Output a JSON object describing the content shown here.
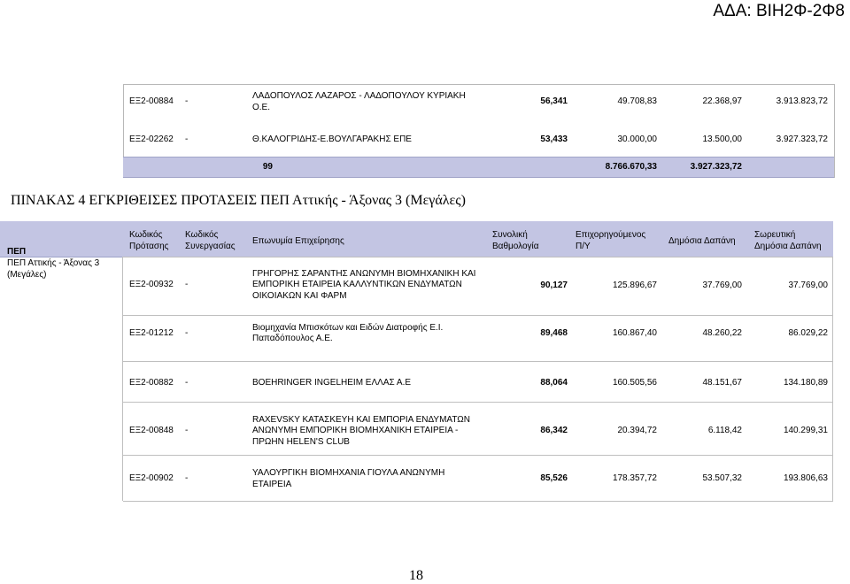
{
  "header_stamp": "ΑΔΑ: ΒΙΗ2Φ-2Φ8",
  "prev_rows": [
    {
      "code": "ΕΞ2-00884",
      "partner": "-",
      "name_lines": [
        "ΛΑΔΟΠΟΥΛΟΣ ΛΑΖΑΡΟΣ - ΛΑΔΟΠΟΥΛΟΥ ΚΥΡΙΑΚΗ",
        "Ο.Ε."
      ],
      "score": "56,341",
      "budget": "49.708,83",
      "public": "22.368,97",
      "cumulative": "3.913.823,72"
    },
    {
      "code": "ΕΞ2-02262",
      "partner": "-",
      "name_lines": [
        "Θ.ΚΑΛΟΓΡΙΔΗΣ-Ε.ΒΟΥΛΓΑΡΑΚΗΣ ΕΠΕ"
      ],
      "score": "53,433",
      "budget": "30.000,00",
      "public": "13.500,00",
      "cumulative": "3.927.323,72"
    }
  ],
  "totals": {
    "count": "99",
    "budget": "8.766.670,33",
    "public": "3.927.323,72"
  },
  "section_title": "ΠΙΝΑΚΑΣ 4 ΕΓΚΡΙΘΕΙΣΕΣ ΠΡΟΤΑΣΕΙΣ ΠΕΠ Αττικής - Άξονας 3 (Μεγάλες)",
  "headers": {
    "pep": "ΠΕΠ",
    "code": [
      "Κωδικός",
      "Πρότασης"
    ],
    "partner": [
      "Κωδικός",
      "Συνεργασίας"
    ],
    "name": "Επωνυμία Επιχείρησης",
    "score": [
      "Συνολική",
      "Βαθμολογία"
    ],
    "budget": [
      "Επιχορηγούμενος",
      "Π/Υ"
    ],
    "public": "Δημόσια Δαπάνη",
    "cumulative": [
      "Σωρευτική",
      "Δημόσια Δαπάνη"
    ]
  },
  "pep_value": [
    "ΠΕΠ Αττικής - Άξονας 3",
    "(Μεγάλες)"
  ],
  "rows": [
    {
      "code": "ΕΞ2-00932",
      "partner": "-",
      "name_lines": [
        "ΓΡΗΓΟΡΗΣ ΣΑΡΑΝΤΗΣ ΑΝΩΝΥΜΗ ΒΙΟΜΗΧΑΝΙΚΗ ΚΑΙ",
        "ΕΜΠΟΡΙΚΗ ΕΤΑΙΡΕΙΑ ΚΑΛΛΥΝΤΙΚΩΝ ΕΝΔΥΜΑΤΩΝ",
        "ΟΙΚΟΙΑΚΩΝ ΚΑΙ ΦΑΡΜ"
      ],
      "score": "90,127",
      "budget": "125.896,67",
      "public": "37.769,00",
      "cumulative": "37.769,00"
    },
    {
      "code": "ΕΞ2-01212",
      "partner": "-",
      "name_lines": [
        "Βιομηχανία Μπισκότων και Ειδών Διατροφής Ε.Ι.",
        "Παπαδόπουλος Α.Ε."
      ],
      "score": "89,468",
      "budget": "160.867,40",
      "public": "48.260,22",
      "cumulative": "86.029,22"
    },
    {
      "code": "ΕΞ2-00882",
      "partner": "-",
      "name_lines": [
        "BOEHRINGER INGELHEIM ΕΛΛΑΣ Α.Ε"
      ],
      "score": "88,064",
      "budget": "160.505,56",
      "public": "48.151,67",
      "cumulative": "134.180,89"
    },
    {
      "code": "ΕΞ2-00848",
      "partner": "-",
      "name_lines": [
        "RAXEVSKY ΚΑΤΑΣΚΕΥΗ ΚΑΙ ΕΜΠΟΡΙΑ ΕΝΔΥΜΑΤΩΝ",
        "ΑΝΩΝΥΜΗ ΕΜΠΟΡΙΚΗ ΒΙΟΜΗΧΑΝΙΚΗ ΕΤΑΙΡΕΙΑ -",
        "ΠΡΩΗΝ HELEN'S CLUB"
      ],
      "score": "86,342",
      "budget": "20.394,72",
      "public": "6.118,42",
      "cumulative": "140.299,31"
    },
    {
      "code": "ΕΞ2-00902",
      "partner": "-",
      "name_lines": [
        "ΥΑΛΟΥΡΓΙΚΗ ΒΙΟΜΗΧΑΝΙΑ ΓΙΟΥΛΑ ΑΝΩΝΥΜΗ",
        "ΕΤΑΙΡΕΙΑ"
      ],
      "score": "85,526",
      "budget": "178.357,72",
      "public": "53.507,32",
      "cumulative": "193.806,63"
    }
  ],
  "page_number": "18"
}
